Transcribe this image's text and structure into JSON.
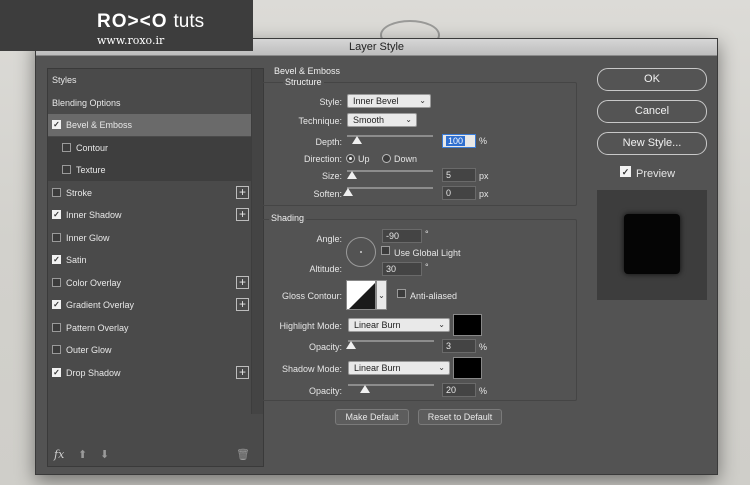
{
  "logo": {
    "brand": "RO><O",
    "brand_suffix": "tuts",
    "url": "www.roxo.ir"
  },
  "dialog": {
    "title": "Layer Style"
  },
  "styles_list": {
    "items": [
      {
        "label": "Styles",
        "checkbox": null,
        "plus": false,
        "state": ""
      },
      {
        "label": "Blending Options",
        "checkbox": null,
        "plus": false,
        "state": ""
      },
      {
        "label": "Bevel & Emboss",
        "checkbox": true,
        "plus": false,
        "state": "sel"
      },
      {
        "label": "Contour",
        "checkbox": false,
        "plus": false,
        "state": "sub"
      },
      {
        "label": "Texture",
        "checkbox": false,
        "plus": false,
        "state": "sub"
      },
      {
        "label": "Stroke",
        "checkbox": false,
        "plus": true,
        "state": ""
      },
      {
        "label": "Inner Shadow",
        "checkbox": true,
        "plus": true,
        "state": ""
      },
      {
        "label": "Inner Glow",
        "checkbox": false,
        "plus": false,
        "state": ""
      },
      {
        "label": "Satin",
        "checkbox": true,
        "plus": false,
        "state": ""
      },
      {
        "label": "Color Overlay",
        "checkbox": false,
        "plus": true,
        "state": ""
      },
      {
        "label": "Gradient Overlay",
        "checkbox": true,
        "plus": true,
        "state": ""
      },
      {
        "label": "Pattern Overlay",
        "checkbox": false,
        "plus": false,
        "state": ""
      },
      {
        "label": "Outer Glow",
        "checkbox": false,
        "plus": false,
        "state": ""
      },
      {
        "label": "Drop Shadow",
        "checkbox": true,
        "plus": true,
        "state": ""
      }
    ],
    "fx_label": "fx"
  },
  "bevel": {
    "title": "Bevel & Emboss",
    "structure_title": "Structure",
    "style_label": "Style:",
    "style_value": "Inner Bevel",
    "technique_label": "Technique:",
    "technique_value": "Smooth",
    "depth_label": "Depth:",
    "depth_value": "100",
    "depth_unit": "%",
    "direction_label": "Direction:",
    "direction_up": "Up",
    "direction_down": "Down",
    "size_label": "Size:",
    "size_value": "5",
    "size_unit": "px",
    "soften_label": "Soften:",
    "soften_value": "0",
    "soften_unit": "px"
  },
  "shading": {
    "title": "Shading",
    "angle_label": "Angle:",
    "angle_value": "-90",
    "angle_unit": "°",
    "global_light_label": "Use Global Light",
    "altitude_label": "Altitude:",
    "altitude_value": "30",
    "altitude_unit": "°",
    "gloss_label": "Gloss Contour:",
    "anti_aliased_label": "Anti-aliased",
    "highlight_mode_label": "Highlight Mode:",
    "highlight_mode_value": "Linear Burn",
    "highlight_color": "#000000",
    "highlight_opacity_label": "Opacity:",
    "highlight_opacity_value": "3",
    "highlight_opacity_unit": "%",
    "shadow_mode_label": "Shadow Mode:",
    "shadow_mode_value": "Linear Burn",
    "shadow_color": "#000000",
    "shadow_opacity_label": "Opacity:",
    "shadow_opacity_value": "20",
    "shadow_opacity_unit": "%"
  },
  "footer": {
    "make_default": "Make Default",
    "reset_default": "Reset to Default"
  },
  "buttons": {
    "ok": "OK",
    "cancel": "Cancel",
    "new_style": "New Style...",
    "preview_label": "Preview"
  }
}
